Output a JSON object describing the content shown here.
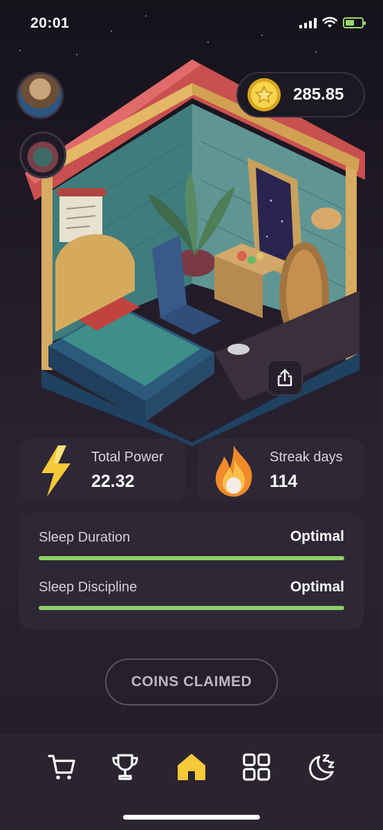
{
  "status_bar": {
    "time": "20:01"
  },
  "header": {
    "coin_balance": "285.85"
  },
  "stats": {
    "total_power": {
      "label": "Total Power",
      "value": "22.32"
    },
    "streak": {
      "label": "Streak days",
      "value": "114"
    }
  },
  "sleep": [
    {
      "label": "Sleep Duration",
      "status": "Optimal",
      "progress": 1.0
    },
    {
      "label": "Sleep Discipline",
      "status": "Optimal",
      "progress": 1.0
    }
  ],
  "claim_button": {
    "label": "COINS CLAIMED"
  },
  "tabs": [
    {
      "name": "shop",
      "icon": "cart-icon",
      "active": false
    },
    {
      "name": "leaderboard",
      "icon": "trophy-icon",
      "active": false
    },
    {
      "name": "home",
      "icon": "home-icon",
      "active": true
    },
    {
      "name": "apps",
      "icon": "grid-icon",
      "active": false
    },
    {
      "name": "sleep",
      "icon": "moon-zzz-icon",
      "active": false
    }
  ],
  "colors": {
    "accent_yellow": "#f6c939",
    "progress_green": "#8bd065",
    "card_bg": "#2e2836",
    "tab_bar_bg": "#2a2430"
  }
}
